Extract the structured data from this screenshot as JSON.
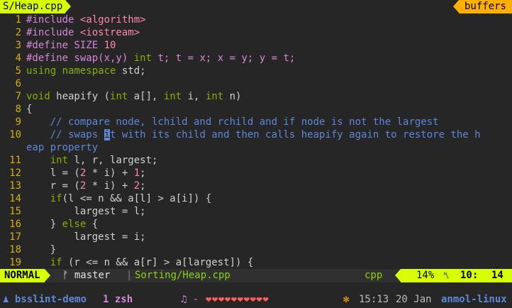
{
  "tabline": {
    "file": "S/Heap.cpp",
    "buffers": "buffers"
  },
  "editor": {
    "lines": [
      {
        "n": "1",
        "tokens": [
          [
            "pre",
            "#include "
          ],
          [
            "inc",
            "<algorithm>"
          ]
        ]
      },
      {
        "n": "2",
        "tokens": [
          [
            "pre",
            "#include "
          ],
          [
            "inc",
            "<iostream>"
          ]
        ]
      },
      {
        "n": "3",
        "tokens": [
          [
            "pre",
            "#define SIZE "
          ],
          [
            "num",
            "10"
          ]
        ]
      },
      {
        "n": "4",
        "tokens": [
          [
            "pre",
            "#define swap(x,y) "
          ],
          [
            "type",
            "int"
          ],
          [
            "pre",
            " t; t = x; x = y; y = t;"
          ]
        ]
      },
      {
        "n": "5",
        "tokens": [
          [
            "type",
            "using"
          ],
          [
            "plain",
            " "
          ],
          [
            "type",
            "namespace"
          ],
          [
            "plain",
            " std;"
          ]
        ]
      },
      {
        "n": "6",
        "tokens": []
      },
      {
        "n": "7",
        "tokens": [
          [
            "type",
            "void"
          ],
          [
            "plain",
            " heapify ("
          ],
          [
            "type",
            "int"
          ],
          [
            "plain",
            " a[], "
          ],
          [
            "type",
            "int"
          ],
          [
            "plain",
            " i, "
          ],
          [
            "type",
            "int"
          ],
          [
            "plain",
            " n)"
          ]
        ]
      },
      {
        "n": "8",
        "tokens": [
          [
            "plain",
            "{"
          ]
        ]
      },
      {
        "n": "9",
        "tokens": [
          [
            "com",
            "    // compare node, lchild and rchild and if node is not the largest"
          ]
        ]
      },
      {
        "n": "10",
        "tokens": [
          [
            "com",
            "    // swaps "
          ],
          [
            "cursor",
            "i"
          ],
          [
            "com",
            "t with its child and then calls heapify again to restore the h"
          ]
        ]
      },
      {
        "n": "",
        "tokens": [
          [
            "com",
            "eap property"
          ]
        ]
      },
      {
        "n": "11",
        "tokens": [
          [
            "type",
            "    int"
          ],
          [
            "plain",
            " l, r, largest;"
          ]
        ]
      },
      {
        "n": "12",
        "tokens": [
          [
            "plain",
            "    l = ("
          ],
          [
            "num",
            "2"
          ],
          [
            "plain",
            " * i) + "
          ],
          [
            "num",
            "1"
          ],
          [
            "plain",
            ";"
          ]
        ]
      },
      {
        "n": "13",
        "tokens": [
          [
            "plain",
            "    r = ("
          ],
          [
            "num",
            "2"
          ],
          [
            "plain",
            " * i) + "
          ],
          [
            "num",
            "2"
          ],
          [
            "plain",
            ";"
          ]
        ]
      },
      {
        "n": "14",
        "tokens": [
          [
            "type",
            "    if"
          ],
          [
            "plain",
            "(l <= n && a[l] > a[i]) {"
          ]
        ]
      },
      {
        "n": "15",
        "tokens": [
          [
            "plain",
            "        largest = l;"
          ]
        ]
      },
      {
        "n": "16",
        "tokens": [
          [
            "plain",
            "    } "
          ],
          [
            "type",
            "else"
          ],
          [
            "plain",
            " {"
          ]
        ]
      },
      {
        "n": "17",
        "tokens": [
          [
            "plain",
            "        largest = i;"
          ]
        ]
      },
      {
        "n": "18",
        "tokens": [
          [
            "plain",
            "    }"
          ]
        ]
      },
      {
        "n": "19",
        "tokens": [
          [
            "type",
            "    if"
          ],
          [
            "plain",
            " (r <= n && a[r] > a[largest]) {"
          ]
        ]
      }
    ]
  },
  "statusline": {
    "mode": "NORMAL",
    "branch_icon": "git-branch-icon",
    "branch": "master",
    "file": "Sorting/Heap.cpp",
    "filetype": "cpp",
    "percent": "14%",
    "line_icon": "line-number-icon",
    "line": "10:",
    "col": "14"
  },
  "tmux": {
    "session_icon": "person-icon",
    "session": "bsslint-demo",
    "window": "1 zsh",
    "music_icon": "music-note-icon",
    "music_sep": "-",
    "hearts": "❤❤❤❤❤❤❤❤❤❤",
    "sun_icon": "sun-icon",
    "time": "15:13",
    "date": "20 Jan",
    "host": "anmol-linux"
  },
  "colors": {
    "background": "#262626",
    "accent_yellow_green": "#d7ff00",
    "buffers_orange": "#ffaf00",
    "line_number": "#d7af00",
    "preproc": "#d787d7",
    "type": "#87af00",
    "comment": "#5f87d7"
  }
}
